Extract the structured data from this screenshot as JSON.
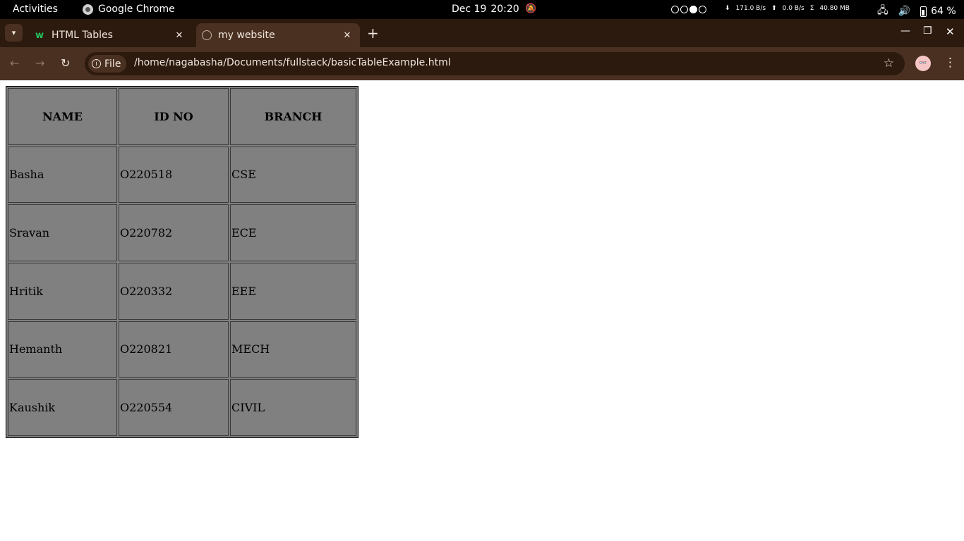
{
  "topbar": {
    "activities": "Activities",
    "app_name": "Google Chrome",
    "date": "Dec 19",
    "time": "20:20",
    "net_down": "171.0 B/s",
    "net_up": "0.0 B/s",
    "net_total": "40.80 MB",
    "battery": "64 %"
  },
  "tabs": [
    {
      "title": "HTML Tables",
      "favicon": "w3-icon"
    },
    {
      "title": "my website",
      "favicon": "globe-icon"
    }
  ],
  "toolbar": {
    "chip_label": "File",
    "url": "/home/nagabasha/Documents/fullstack/basicTableExample.html"
  },
  "table": {
    "headers": [
      "NAME",
      "ID NO",
      "BRANCH"
    ],
    "rows": [
      [
        "Basha",
        "O220518",
        "CSE"
      ],
      [
        "Sravan",
        "O220782",
        "ECE"
      ],
      [
        "Hritik",
        "O220332",
        "EEE"
      ],
      [
        "Hemanth",
        "O220821",
        "MECH"
      ],
      [
        "Kaushik",
        "O220554",
        "CIVIL"
      ]
    ]
  },
  "colors": {
    "table_bg": "#808080",
    "tabstrip_bg": "#2c1a0e",
    "toolbar_bg": "#4a3020"
  }
}
